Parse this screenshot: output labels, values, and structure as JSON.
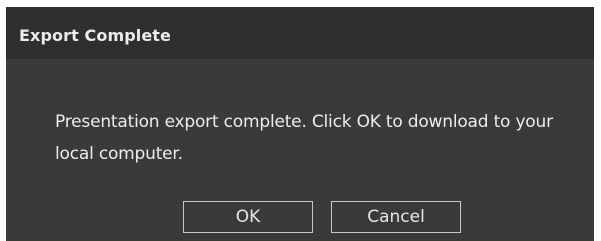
{
  "dialog": {
    "title": "Export Complete",
    "message": "Presentation export complete. Click OK to download to your local computer.",
    "ok_label": "OK",
    "cancel_label": "Cancel"
  },
  "colors": {
    "dialog_background": "#3a3a3a",
    "header_background": "#2f2f2f",
    "text": "#ececec",
    "button_border": "#c8c8c8"
  }
}
